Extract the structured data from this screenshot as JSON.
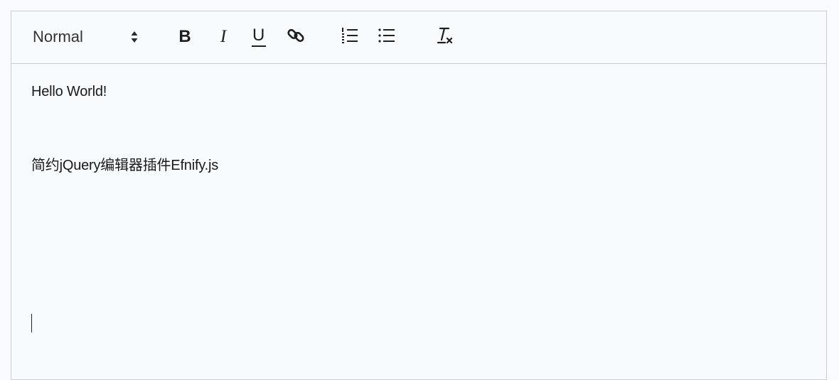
{
  "toolbar": {
    "header_select": {
      "value": "Normal",
      "icon": "up-down-arrows-icon"
    },
    "buttons": [
      {
        "name": "bold",
        "label": "B",
        "icon": "bold-icon"
      },
      {
        "name": "italic",
        "label": "I",
        "icon": "italic-icon"
      },
      {
        "name": "underline",
        "label": "U",
        "icon": "underline-icon"
      },
      {
        "name": "link",
        "icon": "link-icon"
      },
      {
        "name": "ordered-list",
        "icon": "ordered-list-icon"
      },
      {
        "name": "bullet-list",
        "icon": "bullet-list-icon"
      },
      {
        "name": "clean",
        "icon": "clear-format-icon"
      }
    ]
  },
  "content": {
    "lines": [
      "Hello World!",
      "简约jQuery编辑器插件Efnify.js"
    ]
  },
  "colors": {
    "border": "#c9cdd2",
    "background": "#f8fbfe",
    "text": "#1a1a1a"
  }
}
